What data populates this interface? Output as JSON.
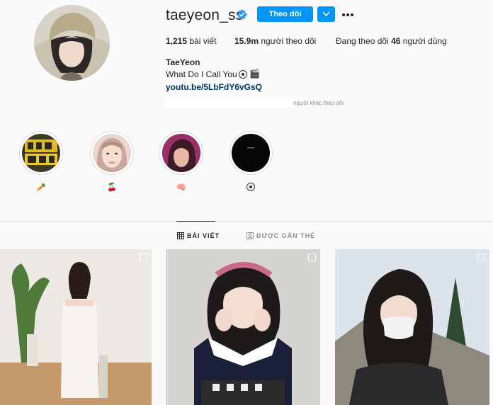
{
  "profile": {
    "username": "taeyeon_ss",
    "follow_label": "Theo dõi",
    "stats": {
      "posts_count": "1,215",
      "posts_label": "bài viết",
      "followers_count": "15.9m",
      "followers_label": "người theo dõi",
      "following_prefix": "Đang theo dõi",
      "following_count": "46",
      "following_suffix": "người dùng"
    },
    "full_name": "TaeYeon",
    "bio": "What Do I Call You",
    "bio_emoji_2": "🎬",
    "link": "youtu.be/5LbFdY6vGsQ",
    "followed_by_suffix": "người khác theo dõi"
  },
  "highlights": [
    {
      "label": "🥕",
      "cover": "tv-show-cover"
    },
    {
      "label": "🍒",
      "cover": "face-cover"
    },
    {
      "label": "🧠",
      "cover": "portrait-cover"
    },
    {
      "label": "",
      "cover": "black-cover",
      "label_icon": "disc-icon"
    }
  ],
  "tabs": {
    "posts": "BÀI VIẾT",
    "tagged": "ĐƯỢC GẮN THẺ"
  },
  "colors": {
    "primary_button": "#0095f6",
    "link": "#00376b",
    "muted": "#8e8e8e",
    "verified": "#3897f0"
  }
}
